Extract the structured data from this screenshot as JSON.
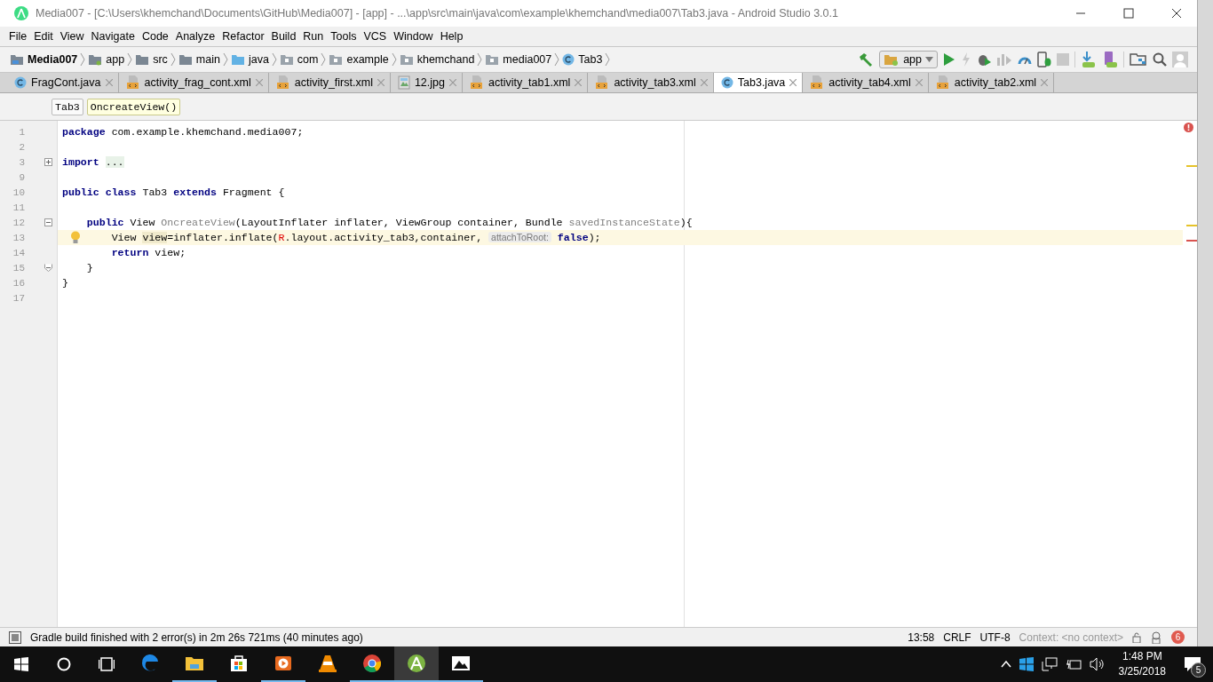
{
  "window": {
    "title": "Media007 - [C:\\Users\\khemchand\\Documents\\GitHub\\Media007] - [app] - ...\\app\\src\\main\\java\\com\\example\\khemchand\\media007\\Tab3.java - Android Studio 3.0.1"
  },
  "menu": [
    "File",
    "Edit",
    "View",
    "Navigate",
    "Code",
    "Analyze",
    "Refactor",
    "Build",
    "Run",
    "Tools",
    "VCS",
    "Window",
    "Help"
  ],
  "breadcrumbs": [
    {
      "label": "Media007",
      "kind": "project"
    },
    {
      "label": "app",
      "kind": "module"
    },
    {
      "label": "src",
      "kind": "folder"
    },
    {
      "label": "main",
      "kind": "folder"
    },
    {
      "label": "java",
      "kind": "source"
    },
    {
      "label": "com",
      "kind": "package"
    },
    {
      "label": "example",
      "kind": "package"
    },
    {
      "label": "khemchand",
      "kind": "package"
    },
    {
      "label": "media007",
      "kind": "package"
    },
    {
      "label": "Tab3",
      "kind": "class"
    }
  ],
  "run_config": "app",
  "tabs": [
    {
      "label": "FragCont.java",
      "kind": "java",
      "selected": false
    },
    {
      "label": "activity_frag_cont.xml",
      "kind": "xml",
      "selected": false
    },
    {
      "label": "activity_first.xml",
      "kind": "xml",
      "selected": false
    },
    {
      "label": "12.jpg",
      "kind": "image",
      "selected": false
    },
    {
      "label": "activity_tab1.xml",
      "kind": "xml",
      "selected": false
    },
    {
      "label": "activity_tab3.xml",
      "kind": "xml",
      "selected": false
    },
    {
      "label": "Tab3.java",
      "kind": "java",
      "selected": true
    },
    {
      "label": "activity_tab4.xml",
      "kind": "xml",
      "selected": false
    },
    {
      "label": "activity_tab2.xml",
      "kind": "xml",
      "selected": false
    }
  ],
  "structure": [
    {
      "label": "Tab3",
      "selected": false
    },
    {
      "label": "OncreateView()",
      "selected": true
    }
  ],
  "code": [
    {
      "number": "1",
      "current": false,
      "kind": "plain",
      "tokens": [
        {
          "text": "package",
          "kind": "kw"
        },
        {
          "text": " com.example.khemchand.media007;",
          "kind": "plain"
        }
      ]
    },
    {
      "number": "2",
      "current": false,
      "kind": "plain"
    },
    {
      "number": "3",
      "current": false,
      "kind": "fold-collapsed",
      "tokens": [
        {
          "text": "import ",
          "kind": "kw"
        },
        {
          "text": "...",
          "kind": "folded"
        }
      ]
    },
    {
      "number": "9",
      "current": false,
      "kind": "plain"
    },
    {
      "number": "10",
      "current": false,
      "kind": "plain",
      "tokens": [
        {
          "text": "public class",
          "kind": "kw"
        },
        {
          "text": " Tab3 ",
          "kind": "plain"
        },
        {
          "text": "extends",
          "kind": "kw"
        },
        {
          "text": " Fragment {",
          "kind": "plain"
        }
      ]
    },
    {
      "number": "11",
      "current": false,
      "kind": "plain"
    },
    {
      "number": "12",
      "current": false,
      "kind": "fold-start",
      "tokens": [
        {
          "text": "    public",
          "kind": "kw"
        },
        {
          "text": " View ",
          "kind": "plain"
        },
        {
          "text": "OncreateView",
          "kind": "unused"
        },
        {
          "text": "(LayoutInflater inflater, ViewGroup container, Bundle ",
          "kind": "plain"
        },
        {
          "text": "savedInstanceState",
          "kind": "unused"
        },
        {
          "text": "){",
          "kind": "plain"
        }
      ]
    },
    {
      "number": "13",
      "current": true,
      "kind": "bulb",
      "tokens": [
        {
          "text": "        View ",
          "kind": "plain"
        },
        {
          "text": "view",
          "kind": "usage"
        },
        {
          "text": "=inflater.inflate(",
          "kind": "plain"
        },
        {
          "text": "R",
          "kind": "error"
        },
        {
          "text": ".layout.activity_tab3,container, ",
          "kind": "plain"
        },
        {
          "text": "attachToRoot:",
          "kind": "hint"
        },
        {
          "text": " false",
          "kind": "kw"
        },
        {
          "text": ");",
          "kind": "plain"
        }
      ]
    },
    {
      "number": "14",
      "current": false,
      "kind": "plain",
      "tokens": [
        {
          "text": "        return",
          "kind": "kw"
        },
        {
          "text": " view;",
          "kind": "plain"
        }
      ]
    },
    {
      "number": "15",
      "current": false,
      "kind": "fold-end",
      "tokens": [
        {
          "text": "    }",
          "kind": "plain"
        }
      ]
    },
    {
      "number": "16",
      "current": false,
      "kind": "plain",
      "tokens": [
        {
          "text": "}",
          "kind": "plain"
        }
      ]
    },
    {
      "number": "17",
      "current": false,
      "kind": "plain"
    }
  ],
  "status_bar": {
    "message": "Gradle build finished with 2 error(s) in 2m 26s 721ms (40 minutes ago)",
    "position": "13:58",
    "line_separator": "CRLF",
    "encoding": "UTF-8",
    "context": "Context: <no context>",
    "notifications": "6"
  },
  "taskbar": {
    "apps": [
      {
        "kind": "edge",
        "running": false,
        "selected": false
      },
      {
        "kind": "explorer",
        "running": true,
        "selected": false
      },
      {
        "kind": "store",
        "running": false,
        "selected": false
      },
      {
        "kind": "media",
        "running": true,
        "selected": false
      },
      {
        "kind": "vlc",
        "running": false,
        "selected": false
      },
      {
        "kind": "chrome",
        "running": true,
        "selected": false
      },
      {
        "kind": "studio",
        "running": true,
        "selected": true
      },
      {
        "kind": "photos",
        "running": true,
        "selected": false
      }
    ],
    "time": "1:48 PM",
    "date": "3/25/2018",
    "notifications": "5"
  }
}
